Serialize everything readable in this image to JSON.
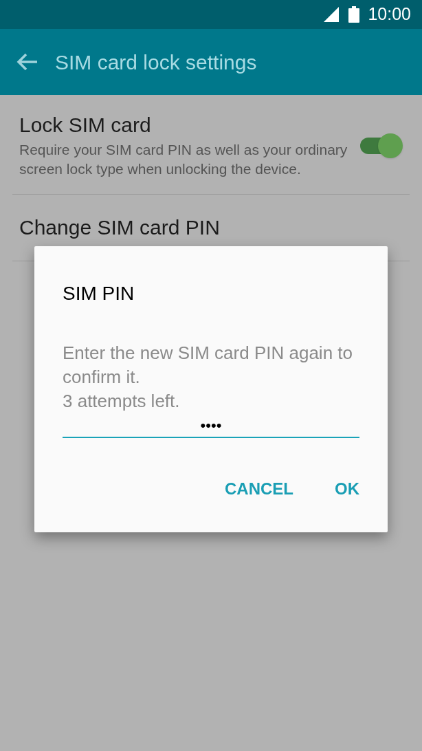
{
  "status_bar": {
    "time": "10:00"
  },
  "app_bar": {
    "title": "SIM card lock settings"
  },
  "settings": [
    {
      "kind": "switch",
      "title": "Lock SIM card",
      "summary": "Require your SIM card PIN as well as your ordinary screen lock type when unlocking the device.",
      "on": true
    },
    {
      "kind": "plain",
      "title": "Change SIM card PIN"
    }
  ],
  "dialog": {
    "title": "SIM PIN",
    "message": "Enter the new SIM card PIN again to confirm it.",
    "attempts": "3 attempts left.",
    "value": "••••",
    "buttons": [
      "CANCEL",
      "OK"
    ]
  }
}
